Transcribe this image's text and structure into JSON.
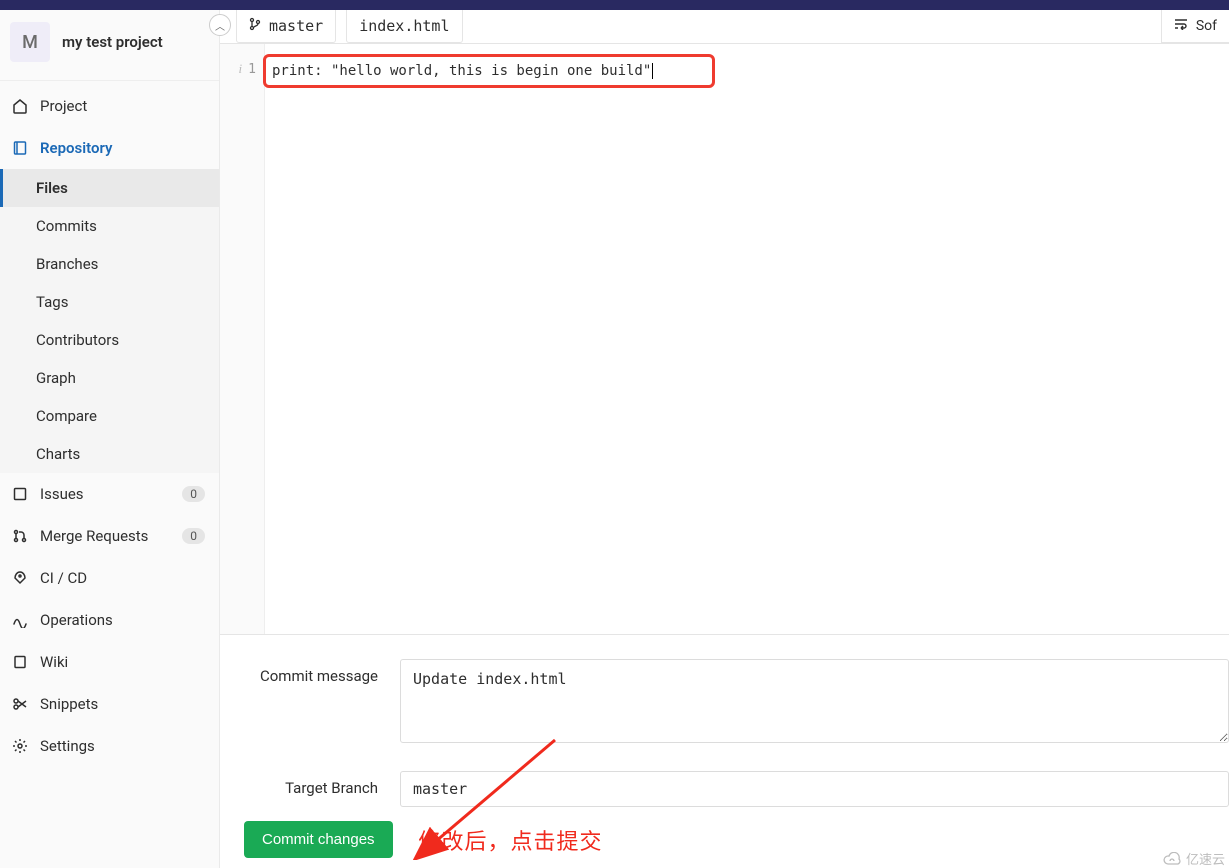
{
  "project": {
    "initial": "M",
    "name": "my test project"
  },
  "sidebar": {
    "project": "Project",
    "repository": "Repository",
    "sub": {
      "files": "Files",
      "commits": "Commits",
      "branches": "Branches",
      "tags": "Tags",
      "contributors": "Contributors",
      "graph": "Graph",
      "compare": "Compare",
      "charts": "Charts"
    },
    "issues": {
      "label": "Issues",
      "count": "0"
    },
    "merge_requests": {
      "label": "Merge Requests",
      "count": "0"
    },
    "cicd": "CI / CD",
    "operations": "Operations",
    "wiki": "Wiki",
    "snippets": "Snippets",
    "settings": "Settings"
  },
  "editor": {
    "branch": "master",
    "file": "index.html",
    "wrap_label": "Sof",
    "line_number": "1",
    "code": "print: \"hello world, this is begin one build\""
  },
  "form": {
    "commit_message_label": "Commit message",
    "commit_message_value": "Update index.html",
    "target_branch_label": "Target Branch",
    "target_branch_value": "master",
    "commit_button": "Commit changes"
  },
  "annotation": {
    "text": "修改后，点击提交"
  },
  "watermark": {
    "text": "亿速云"
  }
}
